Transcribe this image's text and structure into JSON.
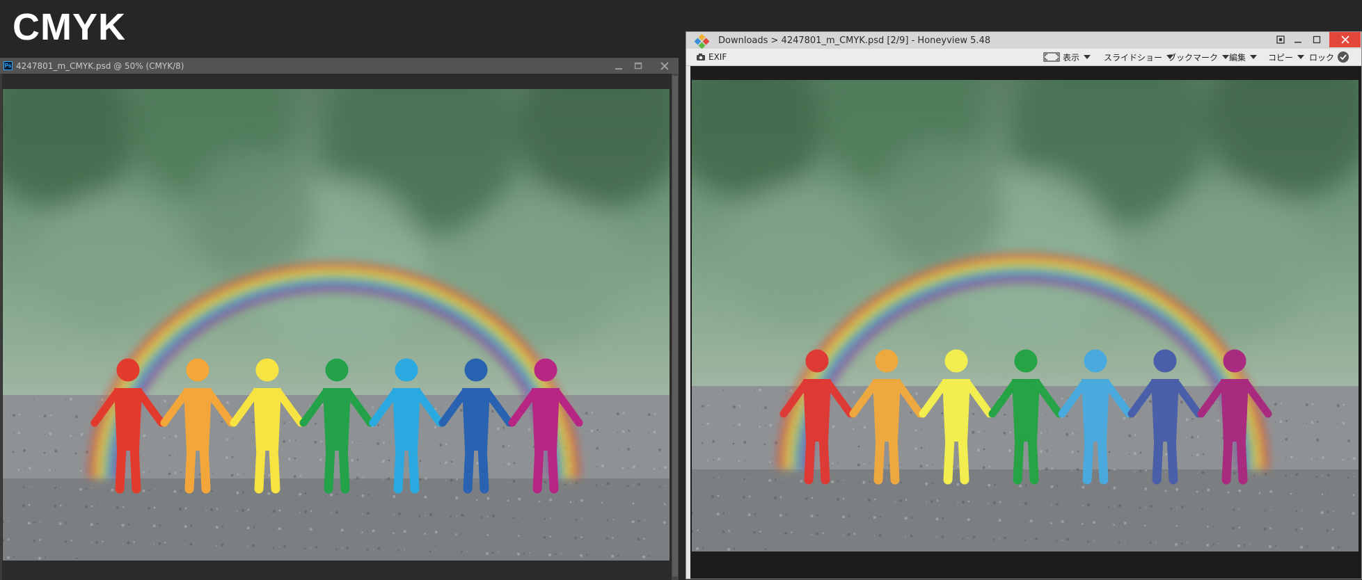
{
  "page_title": "CMYK",
  "photoshop": {
    "title": "4247801_m_CMYK.psd @ 50% (CMYK/8)",
    "app_icon_label": "Ps"
  },
  "honeyview": {
    "title": "Downloads > 4247801_m_CMYK.psd [2/9] - Honeyview 5.48",
    "toolbar": {
      "exif": "EXIF",
      "view": "表示",
      "slideshow": "スライドショー",
      "bookmark": "ブックマーク",
      "edit": "編集",
      "copy": "コピー",
      "lock": "ロック"
    }
  },
  "figure_colors": {
    "ps": [
      "#e23b2e",
      "#f3a73a",
      "#f7e341",
      "#23a24a",
      "#2aa8e0",
      "#2862b0",
      "#b82684"
    ],
    "hv": [
      "#dd3a35",
      "#eea840",
      "#f3ee4f",
      "#25a345",
      "#4aa9dd",
      "#4a5fa9",
      "#a92b80"
    ]
  },
  "colors": {
    "page_bg": "#262626",
    "accent_close": "#e2473a"
  }
}
